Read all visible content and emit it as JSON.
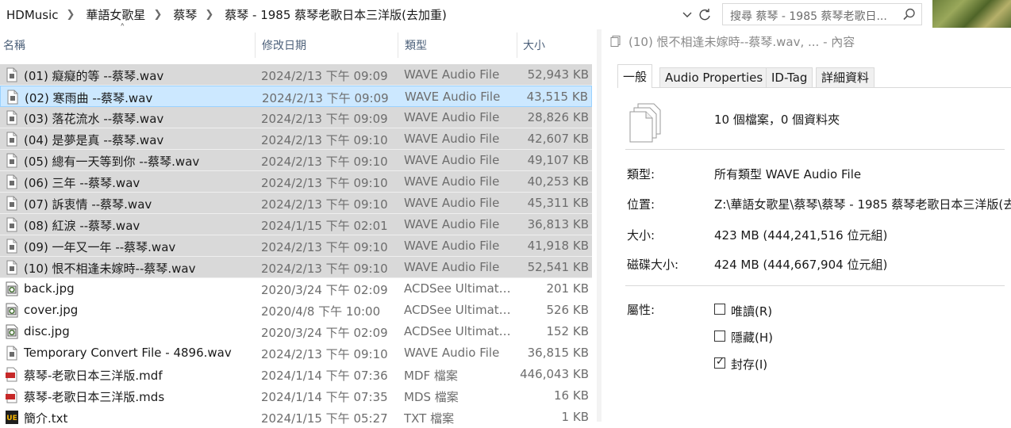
{
  "breadcrumb": [
    "HDMusic",
    "華語女歌星",
    "蔡琴",
    "蔡琴 - 1985 蔡琴老歌日本三洋版(去加重)"
  ],
  "search": {
    "placeholder": "搜尋 蔡琴 - 1985 蔡琴老歌日..."
  },
  "columns": {
    "name": "名稱",
    "date": "修改日期",
    "type": "類型",
    "size": "大小"
  },
  "files": [
    {
      "name": "(01) 癡癡的等 --蔡琴.wav",
      "date": "2024/2/13 下午 09:09",
      "type": "WAVE Audio File",
      "size": "52,943 KB",
      "icon": "wav-file-icon",
      "state": "selected"
    },
    {
      "name": "(02) 寒雨曲 --蔡琴.wav",
      "date": "2024/2/13 下午 09:09",
      "type": "WAVE Audio File",
      "size": "43,515 KB",
      "icon": "wav-file-icon",
      "state": "focused"
    },
    {
      "name": "(03) 落花流水 --蔡琴.wav",
      "date": "2024/2/13 下午 09:09",
      "type": "WAVE Audio File",
      "size": "28,826 KB",
      "icon": "wav-file-icon",
      "state": "selected"
    },
    {
      "name": "(04) 是夢是真 --蔡琴.wav",
      "date": "2024/2/13 下午 09:10",
      "type": "WAVE Audio File",
      "size": "42,607 KB",
      "icon": "wav-file-icon",
      "state": "selected"
    },
    {
      "name": "(05) 總有一天等到你 --蔡琴.wav",
      "date": "2024/2/13 下午 09:10",
      "type": "WAVE Audio File",
      "size": "49,107 KB",
      "icon": "wav-file-icon",
      "state": "selected"
    },
    {
      "name": "(06) 三年 --蔡琴.wav",
      "date": "2024/2/13 下午 09:10",
      "type": "WAVE Audio File",
      "size": "40,253 KB",
      "icon": "wav-file-icon",
      "state": "selected"
    },
    {
      "name": "(07) 訴衷情 --蔡琴.wav",
      "date": "2024/2/13 下午 09:10",
      "type": "WAVE Audio File",
      "size": "45,311 KB",
      "icon": "wav-file-icon",
      "state": "selected"
    },
    {
      "name": "(08) 紅淚 --蔡琴.wav",
      "date": "2024/1/15 下午 02:01",
      "type": "WAVE Audio File",
      "size": "36,813 KB",
      "icon": "wav-file-icon",
      "state": "selected"
    },
    {
      "name": "(09) 一年又一年 --蔡琴.wav",
      "date": "2024/2/13 下午 09:10",
      "type": "WAVE Audio File",
      "size": "41,918 KB",
      "icon": "wav-file-icon",
      "state": "selected"
    },
    {
      "name": "(10) 恨不相逢未嫁時--蔡琴.wav",
      "date": "2024/2/13 下午 09:10",
      "type": "WAVE Audio File",
      "size": "52,541 KB",
      "icon": "wav-file-icon",
      "state": "selected"
    },
    {
      "name": "back.jpg",
      "date": "2020/3/24 下午 02:09",
      "type": "ACDSee Ultimate ...",
      "size": "201 KB",
      "icon": "jpg-file-icon",
      "state": "normal"
    },
    {
      "name": "cover.jpg",
      "date": "2020/4/8 下午 10:00",
      "type": "ACDSee Ultimate ...",
      "size": "526 KB",
      "icon": "jpg-file-icon",
      "state": "normal"
    },
    {
      "name": "disc.jpg",
      "date": "2020/3/24 下午 02:09",
      "type": "ACDSee Ultimate ...",
      "size": "152 KB",
      "icon": "jpg-file-icon",
      "state": "normal"
    },
    {
      "name": "Temporary Convert File - 4896.wav",
      "date": "2024/2/13 下午 09:10",
      "type": "WAVE Audio File",
      "size": "36,815 KB",
      "icon": "wav-file-icon",
      "state": "normal"
    },
    {
      "name": "蔡琴-老歌日本三洋版.mdf",
      "date": "2024/1/14 下午 07:36",
      "type": "MDF 檔案",
      "size": "446,043 KB",
      "icon": "mdf-file-icon",
      "state": "normal"
    },
    {
      "name": "蔡琴-老歌日本三洋版.mds",
      "date": "2024/1/14 下午 07:35",
      "type": "MDS 檔案",
      "size": "16 KB",
      "icon": "mds-file-icon",
      "state": "normal"
    },
    {
      "name": "簡介.txt",
      "date": "2024/1/15 下午 05:27",
      "type": "TXT 檔案",
      "size": "1 KB",
      "icon": "ue-txt-file-icon",
      "state": "normal"
    }
  ],
  "details": {
    "title": "(10) 恨不相逢未嫁時--蔡琴.wav, ... - 內容",
    "tabs": [
      "一般",
      "Audio Properties",
      "ID-Tag",
      "詳細資料"
    ],
    "active_tab": 0,
    "count": "10 個檔案，0 個資料夾",
    "fields": [
      {
        "label": "類型:",
        "value": "所有類型 WAVE Audio File"
      },
      {
        "label": "位置:",
        "value": "Z:\\華語女歌星\\蔡琴\\蔡琴 - 1985 蔡琴老歌日本三洋版(去"
      },
      {
        "label": "大小:",
        "value": "423 MB (444,241,516 位元組)"
      },
      {
        "label": "磁碟大小:",
        "value": "424 MB (444,667,904 位元組)"
      }
    ],
    "attributes_label": "屬性:",
    "attributes": [
      {
        "label": "唯讀(R)",
        "checked": false
      },
      {
        "label": "隱藏(H)",
        "checked": false
      },
      {
        "label": "封存(I)",
        "checked": true
      }
    ]
  },
  "colors": {
    "selected_row": "#d9d9d9",
    "focused_row": "#cce8ff",
    "focused_border": "#99d1ff",
    "header_text": "#4c607a"
  }
}
